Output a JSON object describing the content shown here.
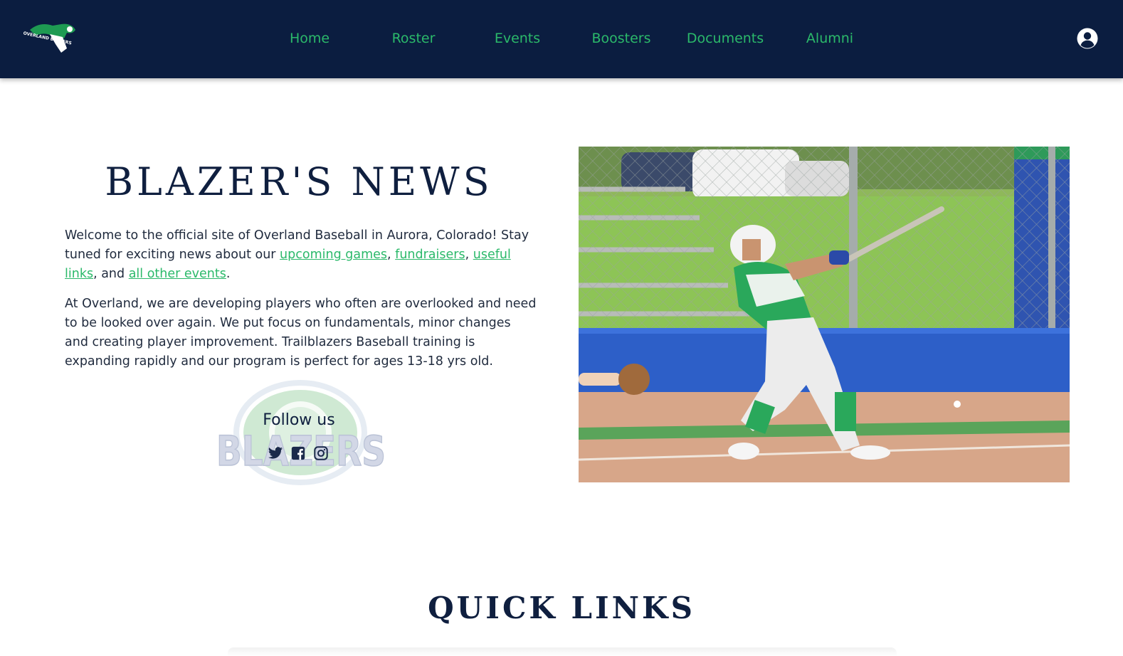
{
  "nav": {
    "logo_alt": "Overland Blazers",
    "items": [
      {
        "label": "Home"
      },
      {
        "label": "Roster"
      },
      {
        "label": "Events"
      },
      {
        "label": "Boosters"
      },
      {
        "label": "Documents"
      },
      {
        "label": "Alumni"
      }
    ],
    "account_icon": "user-circle-icon"
  },
  "news": {
    "title": "BLAZER'S NEWS",
    "p1_text1": "Welcome to the official site of Overland Baseball in Aurora, Colorado! Stay tuned for exciting news about our ",
    "link_upcoming": "upcoming games",
    "sep1": ", ",
    "link_fundraisers": "fundraisers",
    "sep2": ", ",
    "link_useful": "useful links",
    "sep3": ", and ",
    "link_events": "all other events",
    "end": ".",
    "p2": "At Overland, we are developing players who often are overlooked and need to be looked over again. We put focus on fundamentals, minor changes and creating player improvement. Trailblazers Baseball training is expanding rapidly and our program is perfect for ages 13-18 yrs old."
  },
  "follow": {
    "label": "Follow us",
    "watermark": "BLAZERS",
    "icons": [
      "twitter-icon",
      "facebook-icon",
      "instagram-icon"
    ]
  },
  "quick_links": {
    "title": "QUICK LINKS"
  },
  "colors": {
    "nav_bg": "#0b1d40",
    "accent_green": "#2bb96a",
    "text_dark": "#0f1f3f"
  }
}
